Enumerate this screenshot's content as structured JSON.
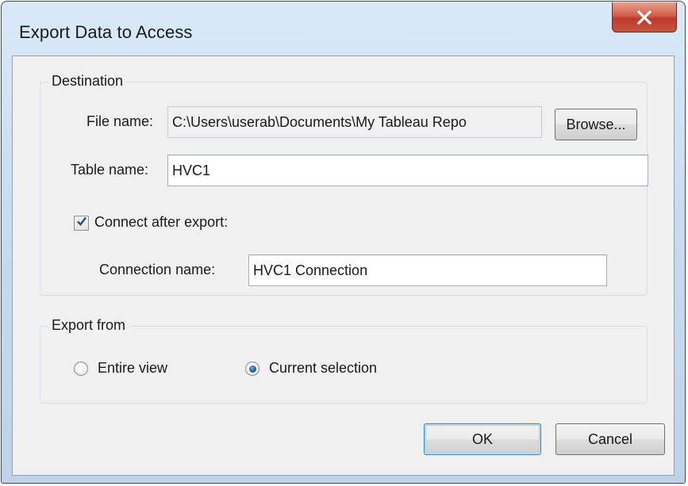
{
  "dialog": {
    "title": "Export Data to Access",
    "close_icon": "close-x-icon"
  },
  "destination": {
    "group_label": "Destination",
    "file_name_label": "File name:",
    "file_name_value": "C:\\Users\\userab\\Documents\\My Tableau Repo",
    "browse_label": "Browse...",
    "table_name_label": "Table name:",
    "table_name_value": "HVC1",
    "connect_after_export_label": "Connect after export:",
    "connect_after_export_checked": true,
    "connection_name_label": "Connection name:",
    "connection_name_value": "HVC1 Connection"
  },
  "export_from": {
    "group_label": "Export from",
    "options": [
      {
        "label": "Entire view",
        "selected": false
      },
      {
        "label": "Current selection",
        "selected": true
      }
    ]
  },
  "footer": {
    "ok_label": "OK",
    "cancel_label": "Cancel"
  },
  "colors": {
    "title_bar": "#c8dcf0",
    "close_button": "#c8533f",
    "dialog_face": "#f0f0f0",
    "default_button_border": "#3c7fb1"
  }
}
